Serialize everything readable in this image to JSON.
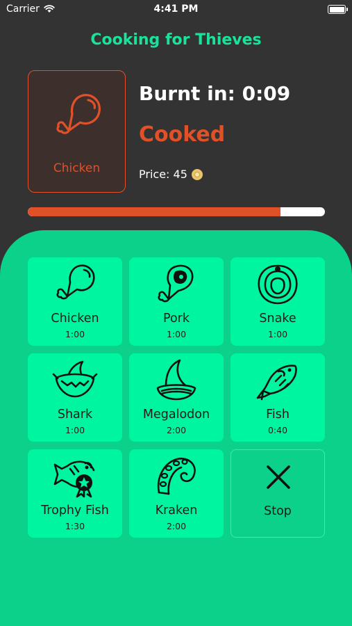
{
  "status_bar": {
    "carrier": "Carrier",
    "time": "4:41 PM"
  },
  "app": {
    "title": "Cooking for Thieves"
  },
  "current": {
    "item": "Chicken",
    "timer_label": "Burnt in: 0:09",
    "state": "Cooked",
    "price_label": "Price: 45",
    "progress_fraction": 0.85
  },
  "foods": [
    {
      "name": "Chicken",
      "time": "1:00",
      "icon": "chicken-leg-icon"
    },
    {
      "name": "Pork",
      "time": "1:00",
      "icon": "pork-icon"
    },
    {
      "name": "Snake",
      "time": "1:00",
      "icon": "snake-icon"
    },
    {
      "name": "Shark",
      "time": "1:00",
      "icon": "shark-icon"
    },
    {
      "name": "Megalodon",
      "time": "2:00",
      "icon": "megalodon-fin-icon"
    },
    {
      "name": "Fish",
      "time": "0:40",
      "icon": "fish-icon"
    },
    {
      "name": "Trophy Fish",
      "time": "1:30",
      "icon": "trophy-fish-icon"
    },
    {
      "name": "Kraken",
      "time": "2:00",
      "icon": "kraken-tentacle-icon"
    }
  ],
  "stop": {
    "label": "Stop",
    "icon": "close-x-icon"
  },
  "colors": {
    "accent": "#19e39a",
    "cooked": "#e0512a",
    "panel": "#0bd18a",
    "tile": "#00f5a0",
    "background": "#333333"
  }
}
